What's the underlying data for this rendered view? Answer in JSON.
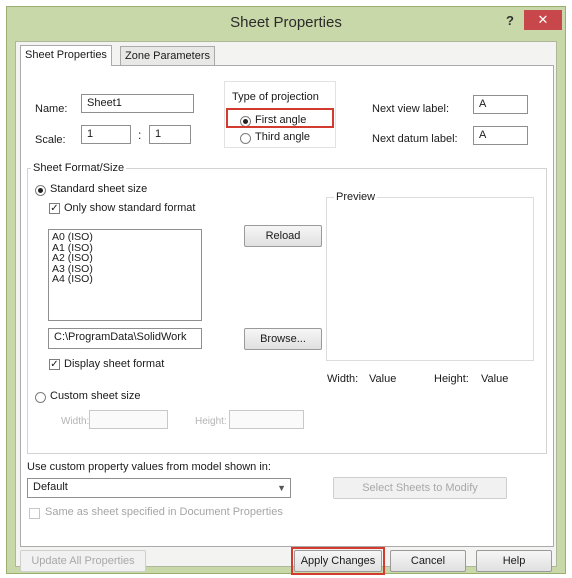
{
  "window": {
    "title": "Sheet Properties",
    "help_label": "?",
    "close_label": "✕"
  },
  "tabs": [
    {
      "label": "Sheet Properties",
      "active": true
    },
    {
      "label": "Zone Parameters",
      "active": false
    }
  ],
  "sheet": {
    "name_label": "Name:",
    "name_value": "Sheet1",
    "scale_label": "Scale:",
    "scale_num": "1",
    "scale_sep": ":",
    "scale_den": "1"
  },
  "projection": {
    "title": "Type of projection",
    "first_angle": "First angle",
    "third_angle": "Third angle",
    "selected": "First angle"
  },
  "labels": {
    "next_view_label": "Next view label:",
    "next_view_value": "A",
    "next_datum_label": "Next datum label:",
    "next_datum_value": "A"
  },
  "format": {
    "title": "Sheet Format/Size",
    "standard_size": "Standard sheet size",
    "only_standard": "Only show standard format",
    "sizes": [
      "A0 (ISO)",
      "A1 (ISO)",
      "A2 (ISO)",
      "A3 (ISO)",
      "A4 (ISO)"
    ],
    "reload": "Reload",
    "path": "C:\\ProgramData\\SolidWork",
    "browse": "Browse...",
    "display_format": "Display sheet format",
    "custom_size": "Custom sheet size",
    "width_label": "Width:",
    "height_label": "Height:"
  },
  "preview": {
    "title": "Preview",
    "width_label": "Width:",
    "width_value": "Value",
    "height_label": "Height:",
    "height_value": "Value"
  },
  "custom_prop": {
    "label": "Use custom property values from model shown in:",
    "selected": "Default",
    "select_sheets": "Select Sheets to Modify",
    "same_as_sheet": "Same as sheet specified in Document Properties"
  },
  "footer": {
    "update_all": "Update All Properties",
    "apply": "Apply Changes",
    "cancel": "Cancel",
    "help": "Help"
  },
  "colors": {
    "title_bar": "#c9d8a8",
    "close_button": "#c8474a",
    "highlight": "#d43b2f"
  }
}
